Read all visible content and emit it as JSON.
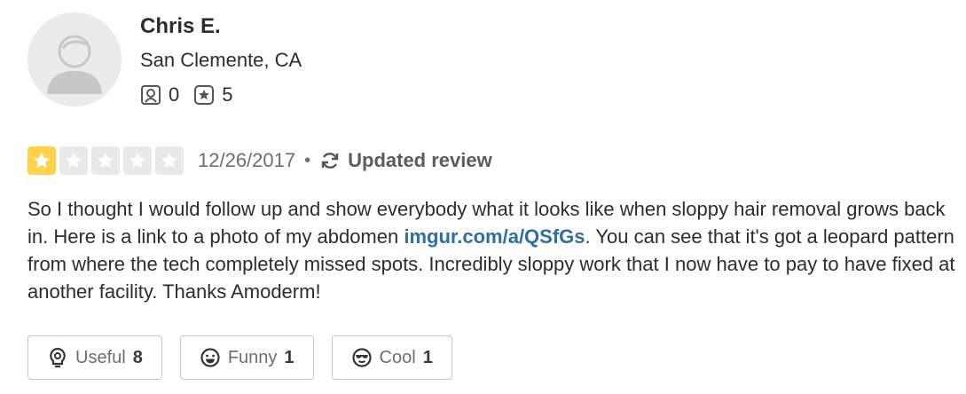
{
  "user": {
    "name": "Chris E.",
    "location": "San Clemente, CA",
    "friends_count": "0",
    "reviews_count": "5",
    "friends_icon": "friends-icon",
    "reviews_icon": "star-badge-icon"
  },
  "review": {
    "rating": 1,
    "max_rating": 5,
    "date": "12/26/2017",
    "separator": "•",
    "updated_label": "Updated review",
    "text_part1": "So I thought I would follow up and show everybody what it looks like when sloppy hair removal grows back in. Here is a link to a photo of my abdomen ",
    "link_text": "imgur.com/a/QSfGs",
    "text_part2": ". You can see that it's got a leopard pattern from where the tech completely missed spots. Incredibly sloppy work that I now have to pay to have fixed at another facility. Thanks Amoderm!"
  },
  "actions": [
    {
      "label": "Useful",
      "count": "8",
      "icon": "lightbulb-icon"
    },
    {
      "label": "Funny",
      "count": "1",
      "icon": "smile-icon"
    },
    {
      "label": "Cool",
      "count": "1",
      "icon": "sunglasses-icon"
    }
  ],
  "colors": {
    "star_filled": "#ffd24a",
    "star_empty": "#e9e9e9",
    "link": "#2f6f9f"
  }
}
